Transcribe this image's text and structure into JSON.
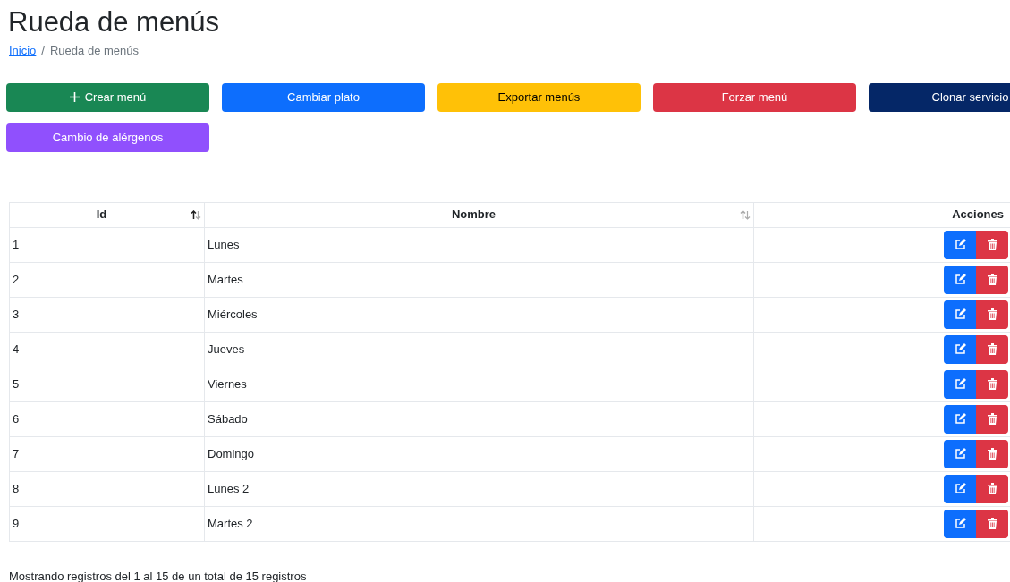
{
  "title": "Rueda de menús",
  "breadcrumb": {
    "separator": "/",
    "items": [
      {
        "label": "Inicio",
        "link": true
      },
      {
        "label": "Rueda de menús",
        "link": false
      }
    ]
  },
  "buttons": [
    {
      "label": "Crear menú"
    },
    {
      "label": "Cambiar plato"
    },
    {
      "label": "Exportar menús"
    },
    {
      "label": "Forzar menú"
    },
    {
      "label": "Clonar servicio"
    },
    {
      "label": "Cambio de alérgenos"
    }
  ],
  "table": {
    "columns": [
      {
        "label": "Id",
        "sorted": true
      },
      {
        "label": "Nombre",
        "sorted": false
      },
      {
        "label": "Acciones"
      }
    ],
    "rows": [
      {
        "id": "1",
        "name": "Lunes"
      },
      {
        "id": "2",
        "name": "Martes"
      },
      {
        "id": "3",
        "name": "Miércoles"
      },
      {
        "id": "4",
        "name": "Jueves"
      },
      {
        "id": "5",
        "name": "Viernes"
      },
      {
        "id": "6",
        "name": "Sábado"
      },
      {
        "id": "7",
        "name": "Domingo"
      },
      {
        "id": "8",
        "name": "Lunes 2"
      },
      {
        "id": "9",
        "name": "Martes 2"
      }
    ]
  },
  "info": "Mostrando registros del 1 al 15 de un total de 15 registros"
}
